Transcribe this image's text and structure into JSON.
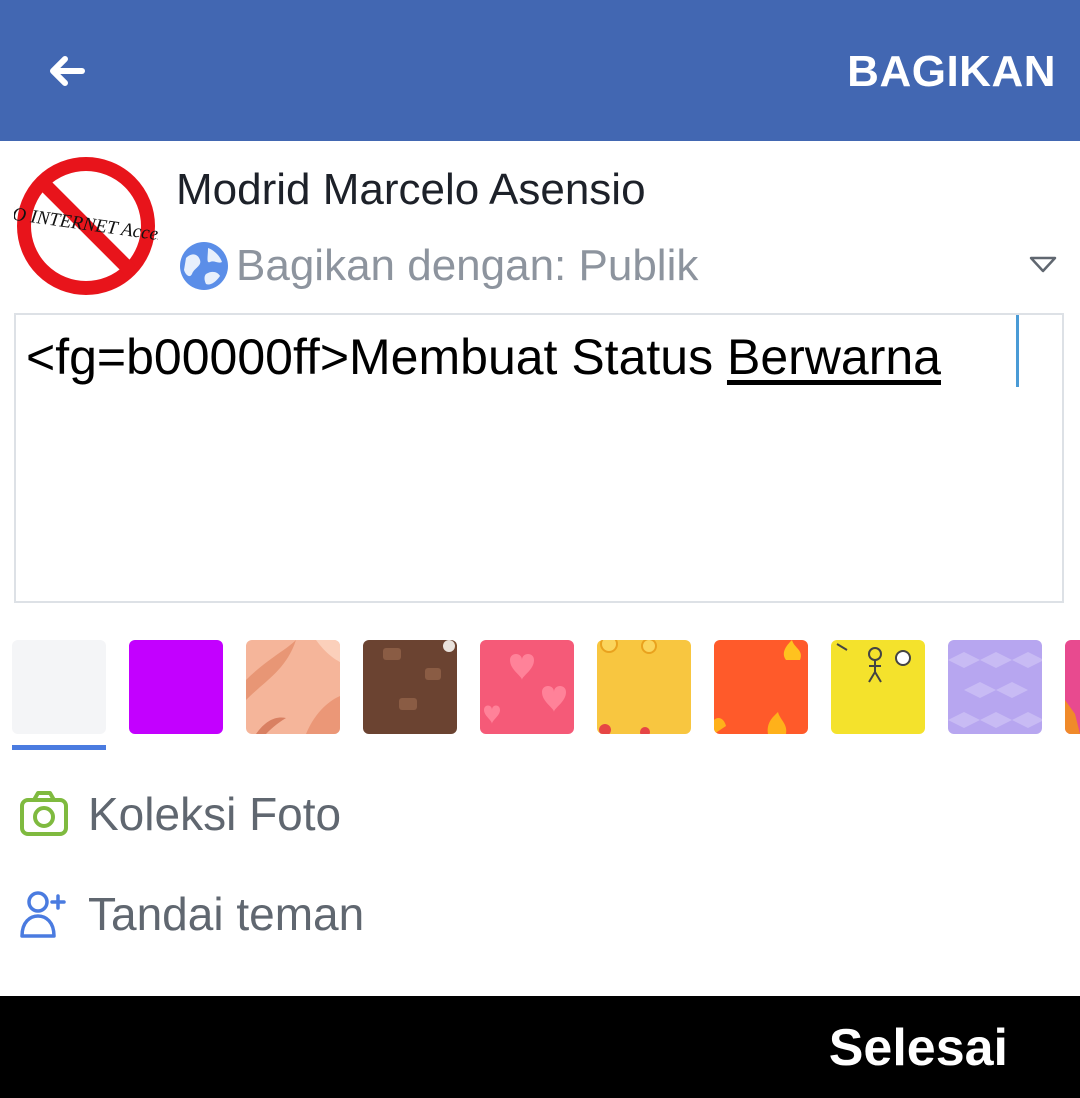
{
  "header": {
    "back_icon": "arrow-left-icon",
    "share_label": "BAGIKAN",
    "bar_color": "#4267b2"
  },
  "user": {
    "name": "Modrid Marcelo Asensio",
    "avatar_text": "NO INTERNET Access"
  },
  "privacy": {
    "label": "Bagikan dengan: Publik",
    "icon": "globe-icon",
    "dropdown_icon": "triangle-down-icon"
  },
  "composer": {
    "text_prefix": "<fg=b00000ff>Membuat Status ",
    "text_underlined": "Berwarna"
  },
  "backgrounds": [
    {
      "name": "plain-white",
      "color": "#f4f5f7",
      "selected": true
    },
    {
      "name": "purple",
      "color": "#c300ff",
      "selected": false
    },
    {
      "name": "peach-leaves",
      "color": "#f5b59a",
      "selected": false
    },
    {
      "name": "chocolate",
      "color": "#6b4331",
      "selected": false
    },
    {
      "name": "hearts",
      "color": "#f55a78",
      "selected": false
    },
    {
      "name": "emoji-yellow",
      "color": "#f8c640",
      "selected": false
    },
    {
      "name": "fire",
      "color": "#ff5a2a",
      "selected": false
    },
    {
      "name": "yellow-doodle",
      "color": "#f4e22c",
      "selected": false
    },
    {
      "name": "lavender-cubes",
      "color": "#b7a6f0",
      "selected": false
    },
    {
      "name": "pink-partial",
      "color": "#e84a8f",
      "selected": false
    }
  ],
  "menu": [
    {
      "icon": "camera-icon",
      "label": "Koleksi Foto"
    },
    {
      "icon": "add-person-icon",
      "label": "Tandai teman"
    }
  ],
  "footer": {
    "done_label": "Selesai"
  }
}
